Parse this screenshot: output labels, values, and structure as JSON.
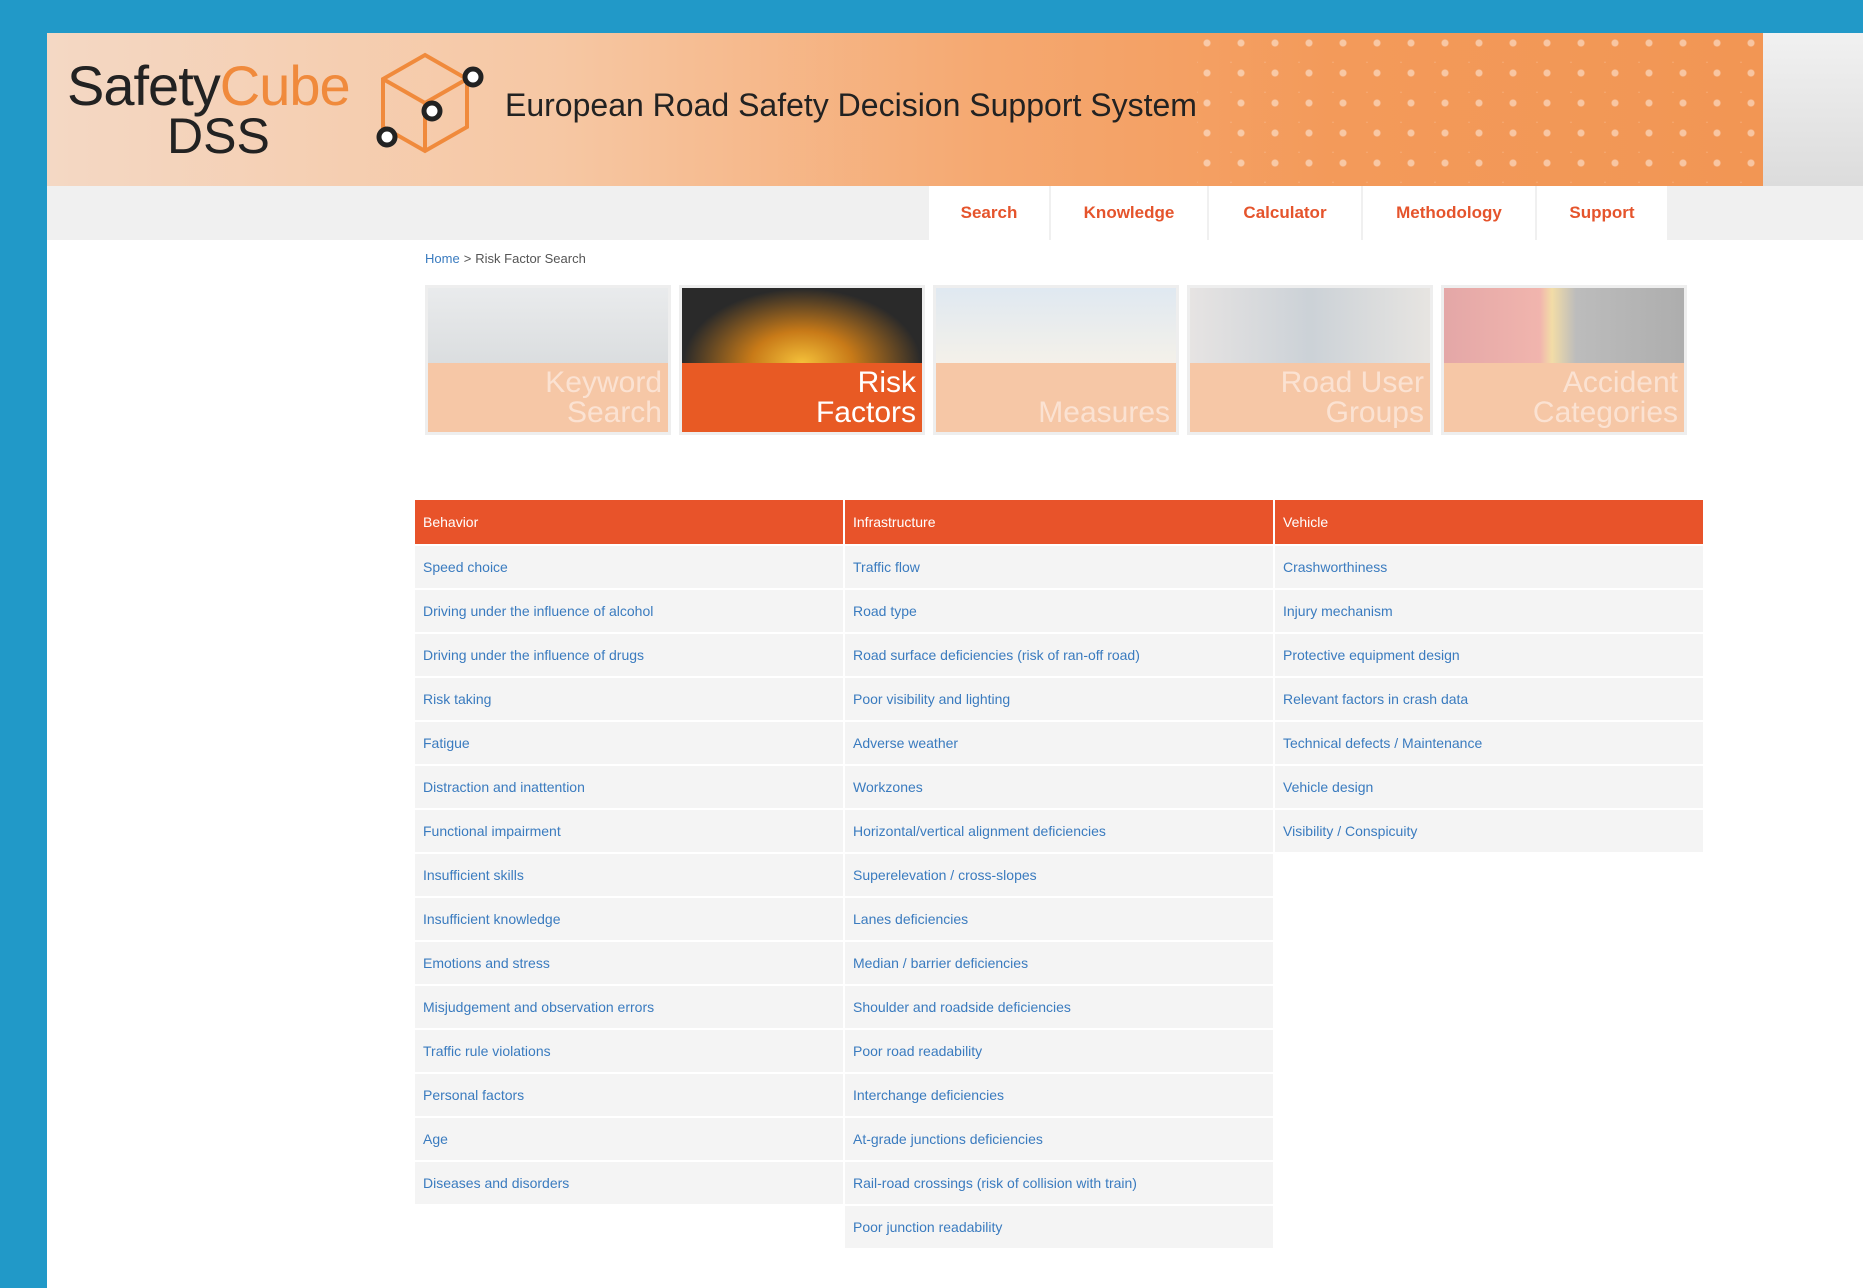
{
  "header": {
    "logo_word_safety": "Safety",
    "logo_word_cube": "Cube",
    "logo_word_dss": "DSS",
    "title": "European Road Safety Decision Support System"
  },
  "nav": [
    {
      "label": "Search"
    },
    {
      "label": "Knowledge"
    },
    {
      "label": "Calculator"
    },
    {
      "label": "Methodology"
    },
    {
      "label": "Support"
    }
  ],
  "breadcrumb": {
    "home": "Home",
    "separator": ">",
    "current": "Risk Factor Search"
  },
  "tiles": [
    {
      "line1": "Keyword",
      "line2": "Search",
      "state": "faded"
    },
    {
      "line1": "Risk",
      "line2": "Factors",
      "state": "active"
    },
    {
      "line1": "",
      "line2": "Measures",
      "state": "faded"
    },
    {
      "line1": "Road User",
      "line2": "Groups",
      "state": "faded"
    },
    {
      "line1": "Accident",
      "line2": "Categories",
      "state": "faded"
    }
  ],
  "table": {
    "columns": [
      {
        "header": "Behavior",
        "items": [
          "Speed choice",
          "Driving under the influence of alcohol",
          "Driving under the influence of drugs",
          "Risk taking",
          "Fatigue",
          "Distraction and inattention",
          "Functional impairment",
          "Insufficient skills",
          "Insufficient knowledge",
          "Emotions and stress",
          "Misjudgement and observation errors",
          "Traffic rule violations",
          "Personal factors",
          "Age",
          "Diseases and disorders"
        ]
      },
      {
        "header": "Infrastructure",
        "items": [
          "Traffic flow",
          "Road type",
          "Road surface deficiencies (risk of ran-off road)",
          "Poor visibility and lighting",
          "Adverse weather",
          "Workzones",
          "Horizontal/vertical alignment deficiencies",
          "Superelevation / cross-slopes",
          "Lanes deficiencies",
          "Median / barrier deficiencies",
          "Shoulder and roadside deficiencies",
          "Poor road readability",
          "Interchange deficiencies",
          "At-grade junctions deficiencies",
          "Rail-road crossings (risk of collision with train)",
          "Poor junction readability"
        ]
      },
      {
        "header": "Vehicle",
        "items": [
          "Crashworthiness",
          "Injury mechanism",
          "Protective equipment design",
          "Relevant factors in crash data",
          "Technical defects / Maintenance",
          "Vehicle design",
          "Visibility / Conspicuity"
        ]
      }
    ]
  },
  "colors": {
    "accent": "#e8532a",
    "link": "#3a7bbf",
    "frame": "#2199c8"
  }
}
